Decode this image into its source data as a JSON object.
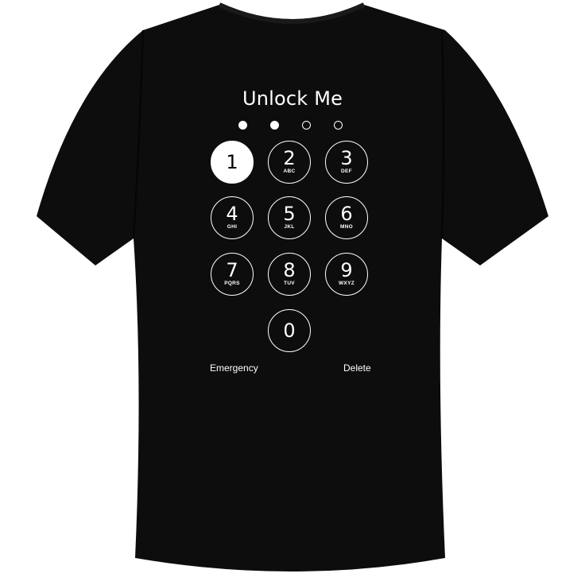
{
  "colors": {
    "background": "#ffffff",
    "shirt": "#0d0d0d",
    "print": "#ffffff"
  },
  "lockscreen": {
    "title": "Unlock Me",
    "passcode_dots": [
      {
        "filled": true
      },
      {
        "filled": true
      },
      {
        "filled": false
      },
      {
        "filled": false
      }
    ],
    "keys": [
      {
        "digit": "1",
        "letters": "",
        "pressed": true
      },
      {
        "digit": "2",
        "letters": "ABC",
        "pressed": false
      },
      {
        "digit": "3",
        "letters": "DEF",
        "pressed": false
      },
      {
        "digit": "4",
        "letters": "GHI",
        "pressed": false
      },
      {
        "digit": "5",
        "letters": "JKL",
        "pressed": false
      },
      {
        "digit": "6",
        "letters": "MNO",
        "pressed": false
      },
      {
        "digit": "7",
        "letters": "PQRS",
        "pressed": false
      },
      {
        "digit": "8",
        "letters": "TUV",
        "pressed": false
      },
      {
        "digit": "9",
        "letters": "WXYZ",
        "pressed": false
      },
      {
        "digit": "0",
        "letters": "",
        "pressed": false
      }
    ],
    "emergency_label": "Emergency",
    "delete_label": "Delete"
  }
}
